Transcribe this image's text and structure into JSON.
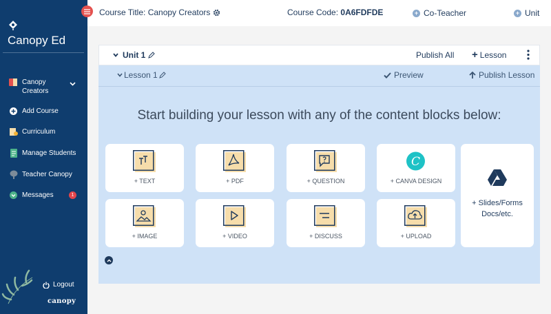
{
  "sidebar": {
    "brand": "Canopy Ed",
    "items": [
      {
        "label": "Canopy Creators",
        "icon": "course-book-icon"
      },
      {
        "label": "Add Course",
        "icon": "plus-circle-icon"
      },
      {
        "label": "Curriculum",
        "icon": "curriculum-icon"
      },
      {
        "label": "Manage Students",
        "icon": "students-icon"
      },
      {
        "label": "Teacher Canopy",
        "icon": "tree-icon"
      },
      {
        "label": "Messages",
        "icon": "messages-icon",
        "badge": "1"
      }
    ],
    "logout": "Logout",
    "footer_brand": "canopy"
  },
  "topbar": {
    "course_title_label": "Course Title: Canopy Creators",
    "course_code_label": "Course Code:",
    "course_code_value": "0A6FDFDE",
    "co_teacher": "Co-Teacher",
    "unit": "Unit"
  },
  "unit": {
    "title": "Unit 1",
    "publish_all": "Publish All",
    "add_lesson": "Lesson"
  },
  "lesson": {
    "title": "Lesson 1",
    "preview": "Preview",
    "publish": "Publish Lesson",
    "heading": "Start building your lesson with any of the content blocks below:"
  },
  "blocks": [
    {
      "label": "+ TEXT",
      "icon": "text-icon"
    },
    {
      "label": "+ PDF",
      "icon": "pdf-icon"
    },
    {
      "label": "+ QUESTION",
      "icon": "question-icon"
    },
    {
      "label": "+ CANVA DESIGN",
      "icon": "canva-icon"
    },
    {
      "label": "+ IMAGE",
      "icon": "image-icon"
    },
    {
      "label": "+ VIDEO",
      "icon": "video-icon"
    },
    {
      "label": "+ DISCUSS",
      "icon": "discuss-icon"
    },
    {
      "label": "+ UPLOAD",
      "icon": "upload-icon"
    }
  ],
  "gdrive": {
    "line1": "+ Slides/Forms",
    "line2": "Docs/etc.",
    "icon": "google-drive-icon"
  },
  "colors": {
    "sidebar": "#0f3d6e",
    "lesson_bg": "#cfe2f7",
    "icon_fill": "#f6ddab",
    "icon_stroke": "#1f3a5c",
    "canva": "#1ec2c6",
    "badge": "#e3454b",
    "menu_button": "#e4524f"
  }
}
